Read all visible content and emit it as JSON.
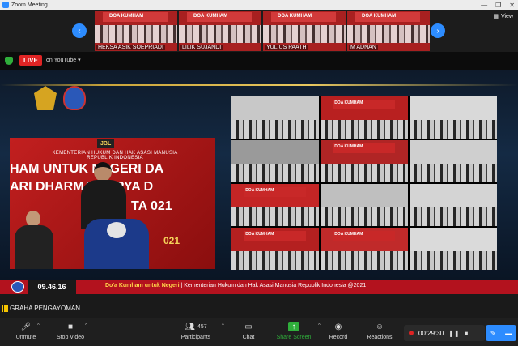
{
  "window": {
    "title": "Zoom Meeting",
    "controls": [
      "—",
      "❐",
      "✕"
    ]
  },
  "thumbnails": {
    "view_label": "View",
    "items": [
      {
        "name": "HEKSA ASIK SOEPRIADI",
        "banner": "DOA KUMHAM"
      },
      {
        "name": "LILIK SUJANDI",
        "banner": "DOA KUMHAM"
      },
      {
        "name": "YULIUS PAATH",
        "banner": "DOA KUMHAM"
      },
      {
        "name": "M ADNAN",
        "banner": "DOA KUMHAM"
      }
    ]
  },
  "live": {
    "badge": "LIVE",
    "text": "on YouTube",
    "caret": "▾"
  },
  "left_screen": {
    "jbl": "JBL",
    "subtitle": "KEMENTERIAN HUKUM DAN HAK ASASI MANUSIA\nREPUBLIK INDONESIA",
    "line1": "HAM UNTUK NEGERI DA",
    "line2": "ARI DHARMA KARYA D",
    "line3": "TA     021",
    "year_small": "021"
  },
  "grid_tiles": [
    {
      "wall": "#c8c8c8",
      "banner": ""
    },
    {
      "wall": "#b82020",
      "banner": "DOA KUMHAM"
    },
    {
      "wall": "#d9d9d9",
      "banner": ""
    },
    {
      "wall": "#9a9a9a",
      "banner": ""
    },
    {
      "wall": "#b02525",
      "banner": "DOA KUMHAM"
    },
    {
      "wall": "#cfcfcf",
      "banner": ""
    },
    {
      "wall": "#c42525",
      "banner": "DOA KUMHAM"
    },
    {
      "wall": "#bfbfbf",
      "banner": ""
    },
    {
      "wall": "#d4d4d4",
      "banner": ""
    },
    {
      "wall": "#b42020",
      "banner": "DOA KUMHAM"
    },
    {
      "wall": "#c02a2a",
      "banner": "DOA KUMHAM"
    },
    {
      "wall": "#dadada",
      "banner": ""
    }
  ],
  "ticker": {
    "clock": "09.46.16",
    "headline": "Do'a Kumham untuk Negeri",
    "rest": " | Kementerian Hukum dan Hak Asasi Manusia Republik Indonesia @2021"
  },
  "speaker_label": "GRAHA PENGAYOMAN",
  "toolbar": {
    "unmute": "Unmute",
    "stop_video": "Stop Video",
    "participants": "Participants",
    "participants_count": "457",
    "chat": "Chat",
    "share_screen": "Share Screen",
    "record": "Record",
    "reactions": "Reactions"
  },
  "recording": {
    "time": "00:29:30",
    "pause": "❚❚",
    "stop": "■"
  },
  "colors": {
    "accent": "#2d8cff",
    "live": "#e02424",
    "share": "#2fae3b",
    "ticker": "#b3121e"
  }
}
